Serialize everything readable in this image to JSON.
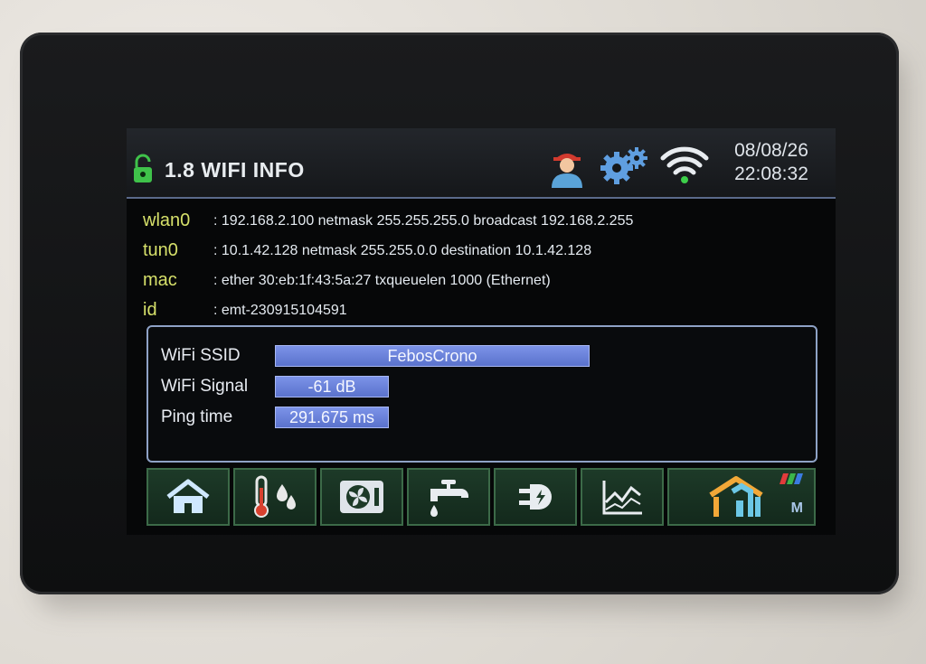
{
  "header": {
    "title": "1.8 WIFI INFO",
    "date": "08/08/26",
    "time": "22:08:32",
    "icons": [
      "lock-icon",
      "user-icon",
      "gear-icon",
      "wifi-icon"
    ]
  },
  "info": [
    {
      "key": "wlan0",
      "value": ": 192.168.2.100 netmask 255.255.255.0 broadcast 192.168.2.255"
    },
    {
      "key": "tun0",
      "value": ": 10.1.42.128 netmask 255.255.0.0 destination 10.1.42.128"
    },
    {
      "key": "mac",
      "value": ": ether 30:eb:1f:43:5a:27 txqueuelen 1000 (Ethernet)"
    },
    {
      "key": "id",
      "value": ": emt-230915104591"
    }
  ],
  "wifi": {
    "ssid_label": "WiFi SSID",
    "ssid_value": "FebosCrono",
    "signal_label": "WiFi Signal",
    "signal_value": "-61 dB",
    "ping_label": "Ping time",
    "ping_value": "291.675 ms"
  },
  "nav": {
    "items": [
      "home-icon",
      "thermometer-humidity-icon",
      "fan-unit-icon",
      "water-tap-icon",
      "power-plug-icon",
      "chart-icon",
      "house-logo-icon"
    ],
    "logo_badge": "M"
  },
  "colors": {
    "key_yellow": "#d6e06a",
    "field_blue": "#6a82dc",
    "nav_green": "#1d3a28",
    "wifi_green": "#3dcf4a"
  }
}
